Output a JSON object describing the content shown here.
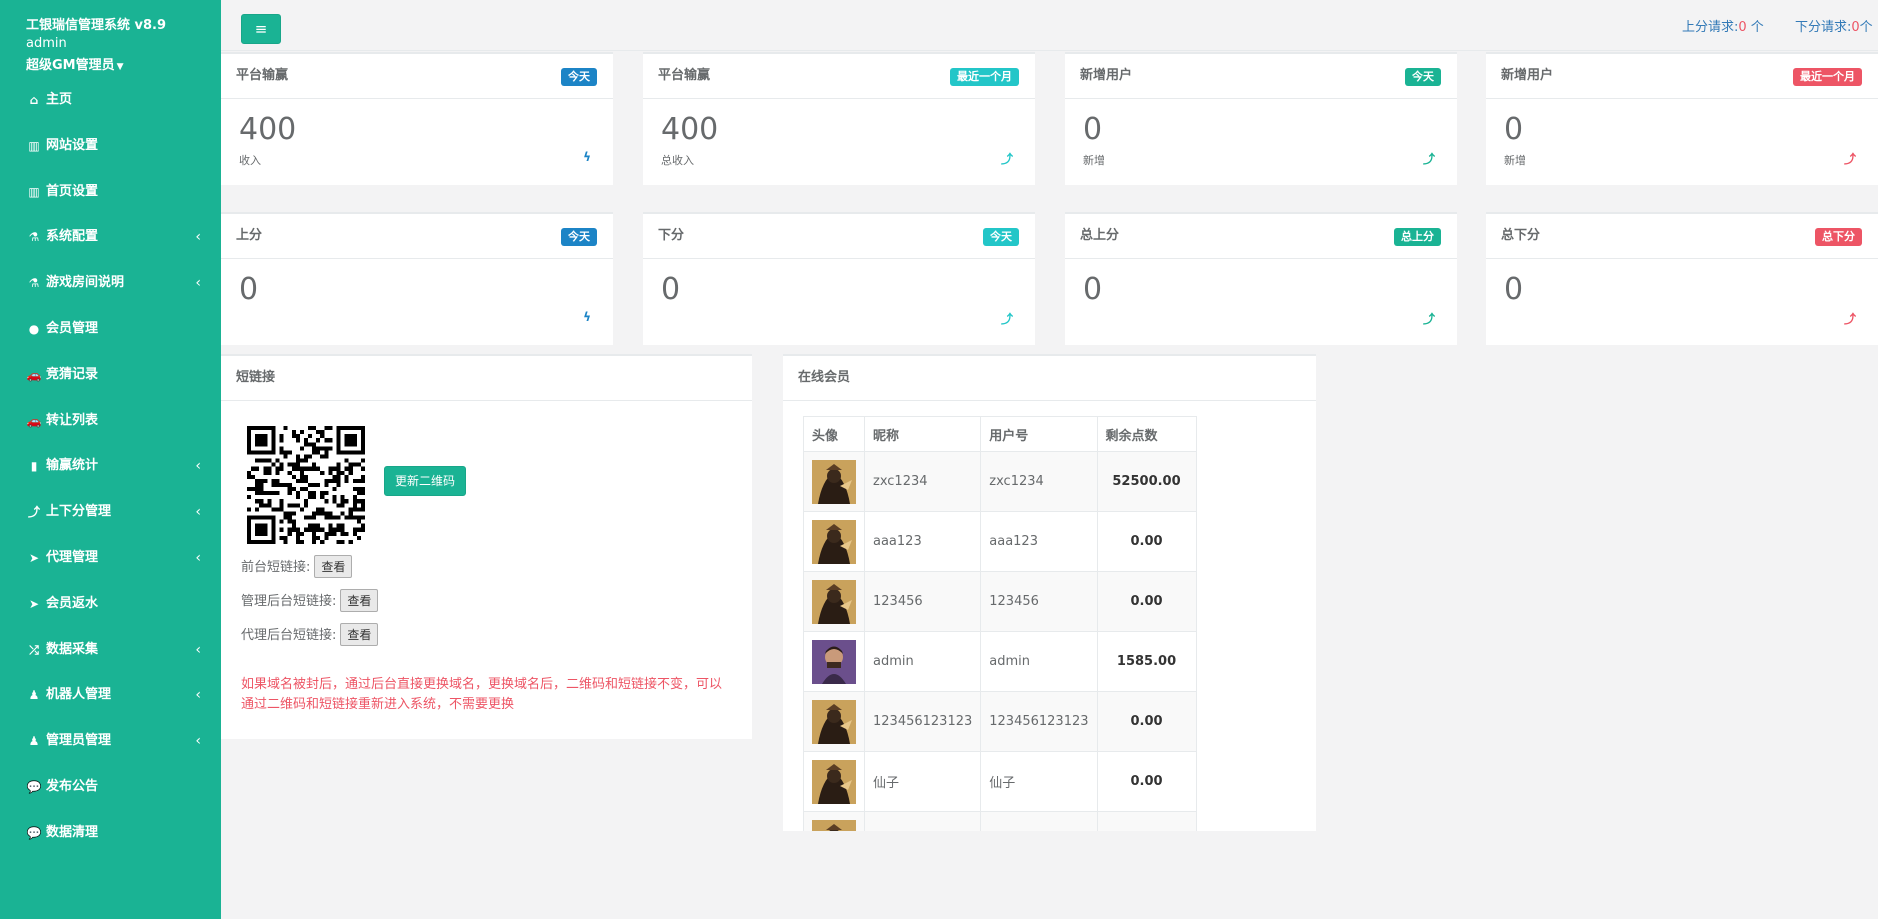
{
  "sidebar": {
    "brand": "工银瑞信管理系统 v8.9",
    "user": "admin",
    "role": "超级GM管理员",
    "items": [
      {
        "label": "主页",
        "icon": "home-icon",
        "glyph": "⌂",
        "chev": ""
      },
      {
        "label": "网站设置",
        "icon": "columns-icon",
        "glyph": "▥",
        "chev": ""
      },
      {
        "label": "首页设置",
        "icon": "columns-icon",
        "glyph": "▥",
        "chev": ""
      },
      {
        "label": "系统配置",
        "icon": "flask-icon",
        "glyph": "⚗",
        "chev": "‹"
      },
      {
        "label": "游戏房间说明",
        "icon": "flask-icon",
        "glyph": "⚗",
        "chev": "‹"
      },
      {
        "label": "会员管理",
        "icon": "user-icon",
        "glyph": "●",
        "chev": ""
      },
      {
        "label": "竞猜记录",
        "icon": "car-icon",
        "glyph": "🚗",
        "chev": ""
      },
      {
        "label": "转让列表",
        "icon": "car-icon",
        "glyph": "🚗",
        "chev": ""
      },
      {
        "label": "输赢统计",
        "icon": "bar-chart-icon",
        "glyph": "▮",
        "chev": "‹"
      },
      {
        "label": "上下分管理",
        "icon": "level-up-icon",
        "glyph": "⤴",
        "chev": "‹"
      },
      {
        "label": "代理管理",
        "icon": "send-icon",
        "glyph": "➤",
        "chev": "‹"
      },
      {
        "label": "会员返水",
        "icon": "send-icon",
        "glyph": "➤",
        "chev": ""
      },
      {
        "label": "数据采集",
        "icon": "random-icon",
        "glyph": "⤮",
        "chev": "‹"
      },
      {
        "label": "机器人管理",
        "icon": "male-icon",
        "glyph": "♟",
        "chev": "‹"
      },
      {
        "label": "管理员管理",
        "icon": "female-icon",
        "glyph": "♟",
        "chev": "‹"
      },
      {
        "label": "发布公告",
        "icon": "comment-icon",
        "glyph": "💬",
        "chev": ""
      },
      {
        "label": "数据清理",
        "icon": "comment-icon",
        "glyph": "💬",
        "chev": ""
      }
    ]
  },
  "topbar": {
    "up_request_label": "上分请求:",
    "up_request_count": "0",
    "up_request_unit": " 个",
    "down_request_label": "下分请求:",
    "down_request_count": "0",
    "down_request_unit": "个"
  },
  "stats_row1": [
    {
      "title": "平台输赢",
      "badge": "今天",
      "badge_color": "#1c84c6",
      "value": "400",
      "sub": "收入",
      "icon_glyph": "ϟ",
      "icon_color": "#1c84c6",
      "icon": "bolt-icon"
    },
    {
      "title": "平台输赢",
      "badge": "最近一个月",
      "badge_color": "#23c6c8",
      "value": "400",
      "sub": "总收入",
      "icon_glyph": "⤴",
      "icon_color": "#23c6c8",
      "icon": "level-up-icon"
    },
    {
      "title": "新增用户",
      "badge": "今天",
      "badge_color": "#1ab394",
      "value": "0",
      "sub": "新增",
      "icon_glyph": "⤴",
      "icon_color": "#1ab394",
      "icon": "level-up-icon"
    },
    {
      "title": "新增用户",
      "badge": "最近一个月",
      "badge_color": "#ed5565",
      "value": "0",
      "sub": "新增",
      "icon_glyph": "⤴",
      "icon_color": "#ed5565",
      "icon": "level-up-icon"
    }
  ],
  "stats_row2": [
    {
      "title": "上分",
      "badge": "今天",
      "badge_color": "#1c84c6",
      "value": "0",
      "icon_glyph": "ϟ",
      "icon_color": "#1c84c6",
      "icon": "bolt-icon"
    },
    {
      "title": "下分",
      "badge": "今天",
      "badge_color": "#23c6c8",
      "value": "0",
      "icon_glyph": "⤴",
      "icon_color": "#23c6c8",
      "icon": "level-up-icon"
    },
    {
      "title": "总上分",
      "badge": "总上分",
      "badge_color": "#1ab394",
      "value": "0",
      "icon_glyph": "⤴",
      "icon_color": "#1ab394",
      "icon": "level-up-icon"
    },
    {
      "title": "总下分",
      "badge": "总下分",
      "badge_color": "#ed5565",
      "value": "0",
      "icon_glyph": "⤴",
      "icon_color": "#ed5565",
      "icon": "level-up-icon"
    }
  ],
  "shortlink": {
    "title": "短链接",
    "refresh_button": "更新二维码",
    "rows": [
      {
        "label": "前台短链接:",
        "button": "查看"
      },
      {
        "label": "管理后台短链接:",
        "button": "查看"
      },
      {
        "label": "代理后台短链接:",
        "button": "查看"
      }
    ],
    "note": "如果域名被封后，通过后台直接更换域名，更换域名后，二维码和短链接不变，可以通过二维码和短链接重新进入系统，不需要更换"
  },
  "online": {
    "title": "在线会员",
    "columns": [
      "头像",
      "昵称",
      "用户号",
      "剩余点数"
    ],
    "rows": [
      {
        "nickname": "zxc1234",
        "userid": "zxc1234",
        "points": "52500.00",
        "avatar": "dark"
      },
      {
        "nickname": "aaa123",
        "userid": "aaa123",
        "points": "0.00",
        "avatar": "dark"
      },
      {
        "nickname": "123456",
        "userid": "123456",
        "points": "0.00",
        "avatar": "dark"
      },
      {
        "nickname": "admin",
        "userid": "admin",
        "points": "1585.00",
        "avatar": "purple"
      },
      {
        "nickname": "123456123123",
        "userid": "123456123123",
        "points": "0.00",
        "avatar": "dark"
      },
      {
        "nickname": "仙子",
        "userid": "仙子",
        "points": "0.00",
        "avatar": "dark"
      },
      {
        "nickname": "",
        "userid": "",
        "points": "",
        "avatar": "dark"
      }
    ]
  }
}
